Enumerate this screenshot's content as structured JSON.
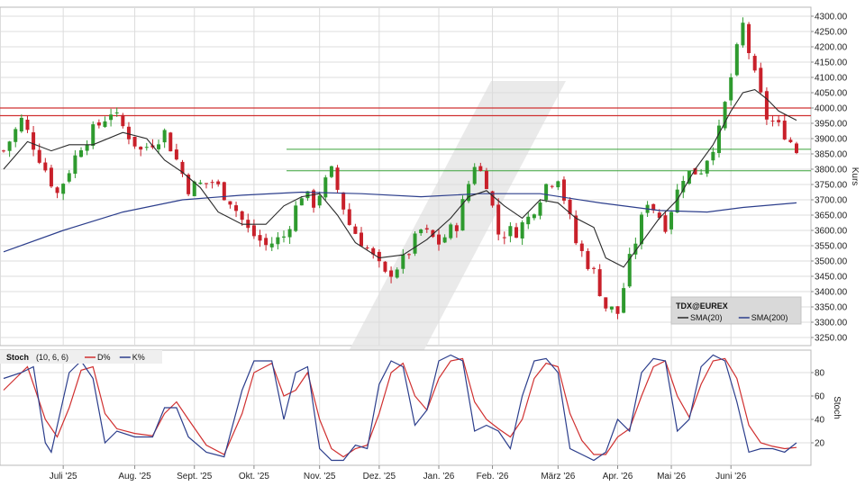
{
  "colors": {
    "up": "#2e9a2e",
    "down": "#c8202a",
    "sma20": "#2a2a2a",
    "sma200": "#2c3e8c",
    "resistance": "#d03030",
    "support": "#3aa33a",
    "stoch_d": "#d03030",
    "stoch_k": "#2c3e8c",
    "grid": "#dcdcdc",
    "watermark": "#e6e6e6"
  },
  "chart_data": [
    {
      "type": "candlestick",
      "title": "",
      "ylabel": "Kurs",
      "ylim": [
        3220,
        4320
      ],
      "grid": true,
      "legend_position": "bottom-right",
      "y_ticks": [
        "3250.00",
        "3300.00",
        "3350.00",
        "3400.00",
        "3450.00",
        "3500.00",
        "3550.00",
        "3600.00",
        "3650.00",
        "3700.00",
        "3750.00",
        "3800.00",
        "3850.00",
        "3900.00",
        "3950.00",
        "4000.00",
        "4050.00",
        "4100.00",
        "4150.00",
        "4200.00",
        "4250.00",
        "4300.00"
      ],
      "legend": {
        "symbol": "TDX@EUREX",
        "series": [
          {
            "name": "SMA(20)",
            "color": "#2a2a2a"
          },
          {
            "name": "SMA(200)",
            "color": "#2c3e8c"
          }
        ]
      },
      "price_path": [
        [
          0,
          3860
        ],
        [
          3,
          3960
        ],
        [
          6,
          3840
        ],
        [
          9,
          3720
        ],
        [
          13,
          3880
        ],
        [
          18,
          3990
        ],
        [
          23,
          3860
        ],
        [
          27,
          3920
        ],
        [
          31,
          3740
        ],
        [
          35,
          3760
        ],
        [
          38,
          3700
        ],
        [
          41,
          3600
        ],
        [
          44,
          3550
        ],
        [
          47,
          3580
        ],
        [
          50,
          3720
        ],
        [
          52,
          3690
        ],
        [
          55,
          3790
        ],
        [
          58,
          3620
        ],
        [
          61,
          3540
        ],
        [
          64,
          3450
        ],
        [
          67,
          3500
        ],
        [
          70,
          3600
        ],
        [
          73,
          3560
        ],
        [
          76,
          3620
        ],
        [
          79,
          3820
        ],
        [
          81,
          3760
        ],
        [
          83,
          3590
        ],
        [
          86,
          3600
        ],
        [
          88,
          3640
        ],
        [
          91,
          3750
        ],
        [
          93,
          3780
        ],
        [
          96,
          3560
        ],
        [
          99,
          3460
        ],
        [
          101,
          3350
        ],
        [
          103,
          3330
        ],
        [
          105,
          3500
        ],
        [
          108,
          3700
        ],
        [
          111,
          3620
        ],
        [
          114,
          3780
        ],
        [
          117,
          3800
        ],
        [
          120,
          3920
        ],
        [
          122,
          4100
        ],
        [
          124,
          4270
        ],
        [
          126,
          4100
        ],
        [
          128,
          3970
        ],
        [
          131,
          3920
        ],
        [
          133,
          3860
        ]
      ],
      "sma20": [
        [
          0,
          3800
        ],
        [
          4,
          3890
        ],
        [
          8,
          3860
        ],
        [
          11,
          3880
        ],
        [
          15,
          3880
        ],
        [
          20,
          3920
        ],
        [
          24,
          3900
        ],
        [
          27,
          3830
        ],
        [
          30,
          3790
        ],
        [
          33,
          3740
        ],
        [
          36,
          3660
        ],
        [
          40,
          3620
        ],
        [
          44,
          3620
        ],
        [
          47,
          3680
        ],
        [
          50,
          3710
        ],
        [
          53,
          3720
        ],
        [
          56,
          3650
        ],
        [
          59,
          3560
        ],
        [
          63,
          3510
        ],
        [
          67,
          3520
        ],
        [
          71,
          3570
        ],
        [
          75,
          3640
        ],
        [
          78,
          3710
        ],
        [
          81,
          3730
        ],
        [
          84,
          3680
        ],
        [
          87,
          3640
        ],
        [
          90,
          3700
        ],
        [
          93,
          3690
        ],
        [
          96,
          3640
        ],
        [
          99,
          3610
        ],
        [
          101,
          3510
        ],
        [
          104,
          3480
        ],
        [
          107,
          3560
        ],
        [
          110,
          3640
        ],
        [
          113,
          3700
        ],
        [
          116,
          3800
        ],
        [
          119,
          3880
        ],
        [
          122,
          3990
        ],
        [
          124,
          4050
        ],
        [
          126,
          4060
        ],
        [
          128,
          4030
        ],
        [
          130,
          3990
        ],
        [
          133,
          3960
        ]
      ],
      "sma200": [
        [
          0,
          3530
        ],
        [
          10,
          3600
        ],
        [
          20,
          3660
        ],
        [
          30,
          3700
        ],
        [
          40,
          3715
        ],
        [
          50,
          3725
        ],
        [
          60,
          3720
        ],
        [
          70,
          3710
        ],
        [
          80,
          3720
        ],
        [
          90,
          3720
        ],
        [
          100,
          3690
        ],
        [
          110,
          3665
        ],
        [
          118,
          3660
        ],
        [
          124,
          3675
        ],
        [
          133,
          3690
        ]
      ],
      "resistance_lines": [
        4000,
        3975
      ],
      "support_lines": [
        3865,
        3795
      ],
      "x_ticks": [
        "Juli '25",
        "Aug. '25",
        "Sept. '25",
        "Okt. '25",
        "Nov. '25",
        "Dez. '25",
        "Jan. '26",
        "Feb. '26",
        "März '26",
        "Apr. '26",
        "Mai '26",
        "Juni '26"
      ],
      "x_tick_index": [
        10,
        22,
        32,
        42,
        53,
        63,
        73,
        82,
        93,
        103,
        112,
        122
      ]
    },
    {
      "type": "line",
      "title": "",
      "ylabel": "Stoch",
      "ylim": [
        0,
        100
      ],
      "y_ticks": [
        "20",
        "40",
        "60",
        "80"
      ],
      "grid": true,
      "legend_position": "top-left",
      "legend": {
        "label": "Stoch",
        "params": "(10, 6, 6)",
        "series": [
          {
            "name": "D%",
            "color": "#d03030"
          },
          {
            "name": "K%",
            "color": "#2c3e8c"
          }
        ]
      },
      "k_path": [
        [
          0,
          75
        ],
        [
          3,
          80
        ],
        [
          5,
          85
        ],
        [
          7,
          20
        ],
        [
          8,
          12
        ],
        [
          11,
          80
        ],
        [
          13,
          90
        ],
        [
          15,
          75
        ],
        [
          17,
          20
        ],
        [
          19,
          30
        ],
        [
          22,
          25
        ],
        [
          25,
          25
        ],
        [
          27,
          50
        ],
        [
          29,
          50
        ],
        [
          31,
          25
        ],
        [
          34,
          12
        ],
        [
          37,
          8
        ],
        [
          40,
          65
        ],
        [
          42,
          90
        ],
        [
          45,
          90
        ],
        [
          47,
          40
        ],
        [
          49,
          80
        ],
        [
          51,
          85
        ],
        [
          53,
          15
        ],
        [
          55,
          5
        ],
        [
          57,
          5
        ],
        [
          59,
          18
        ],
        [
          61,
          15
        ],
        [
          63,
          70
        ],
        [
          65,
          90
        ],
        [
          67,
          85
        ],
        [
          69,
          35
        ],
        [
          71,
          48
        ],
        [
          73,
          90
        ],
        [
          75,
          95
        ],
        [
          77,
          90
        ],
        [
          79,
          30
        ],
        [
          81,
          35
        ],
        [
          83,
          30
        ],
        [
          85,
          15
        ],
        [
          87,
          60
        ],
        [
          89,
          90
        ],
        [
          91,
          92
        ],
        [
          93,
          80
        ],
        [
          95,
          15
        ],
        [
          97,
          10
        ],
        [
          99,
          5
        ],
        [
          101,
          12
        ],
        [
          103,
          40
        ],
        [
          105,
          30
        ],
        [
          107,
          80
        ],
        [
          109,
          92
        ],
        [
          111,
          90
        ],
        [
          113,
          30
        ],
        [
          115,
          40
        ],
        [
          117,
          85
        ],
        [
          119,
          95
        ],
        [
          121,
          90
        ],
        [
          123,
          55
        ],
        [
          125,
          12
        ],
        [
          127,
          15
        ],
        [
          129,
          15
        ],
        [
          131,
          12
        ],
        [
          133,
          20
        ]
      ],
      "d_path": [
        [
          0,
          65
        ],
        [
          2,
          75
        ],
        [
          4,
          85
        ],
        [
          7,
          40
        ],
        [
          9,
          25
        ],
        [
          11,
          50
        ],
        [
          13,
          82
        ],
        [
          15,
          85
        ],
        [
          17,
          45
        ],
        [
          19,
          32
        ],
        [
          22,
          28
        ],
        [
          25,
          26
        ],
        [
          27,
          45
        ],
        [
          29,
          55
        ],
        [
          31,
          40
        ],
        [
          34,
          18
        ],
        [
          37,
          10
        ],
        [
          40,
          45
        ],
        [
          42,
          80
        ],
        [
          45,
          88
        ],
        [
          47,
          60
        ],
        [
          49,
          65
        ],
        [
          51,
          80
        ],
        [
          53,
          40
        ],
        [
          55,
          15
        ],
        [
          57,
          8
        ],
        [
          59,
          15
        ],
        [
          61,
          18
        ],
        [
          63,
          45
        ],
        [
          65,
          80
        ],
        [
          67,
          88
        ],
        [
          69,
          60
        ],
        [
          71,
          48
        ],
        [
          73,
          75
        ],
        [
          75,
          90
        ],
        [
          77,
          92
        ],
        [
          79,
          55
        ],
        [
          81,
          40
        ],
        [
          83,
          32
        ],
        [
          85,
          25
        ],
        [
          87,
          40
        ],
        [
          89,
          75
        ],
        [
          91,
          88
        ],
        [
          93,
          85
        ],
        [
          95,
          45
        ],
        [
          97,
          22
        ],
        [
          99,
          10
        ],
        [
          101,
          10
        ],
        [
          103,
          25
        ],
        [
          105,
          32
        ],
        [
          107,
          60
        ],
        [
          109,
          85
        ],
        [
          111,
          90
        ],
        [
          113,
          60
        ],
        [
          115,
          42
        ],
        [
          117,
          70
        ],
        [
          119,
          90
        ],
        [
          121,
          92
        ],
        [
          123,
          75
        ],
        [
          125,
          35
        ],
        [
          127,
          20
        ],
        [
          129,
          17
        ],
        [
          131,
          15
        ],
        [
          133,
          16
        ]
      ]
    }
  ]
}
